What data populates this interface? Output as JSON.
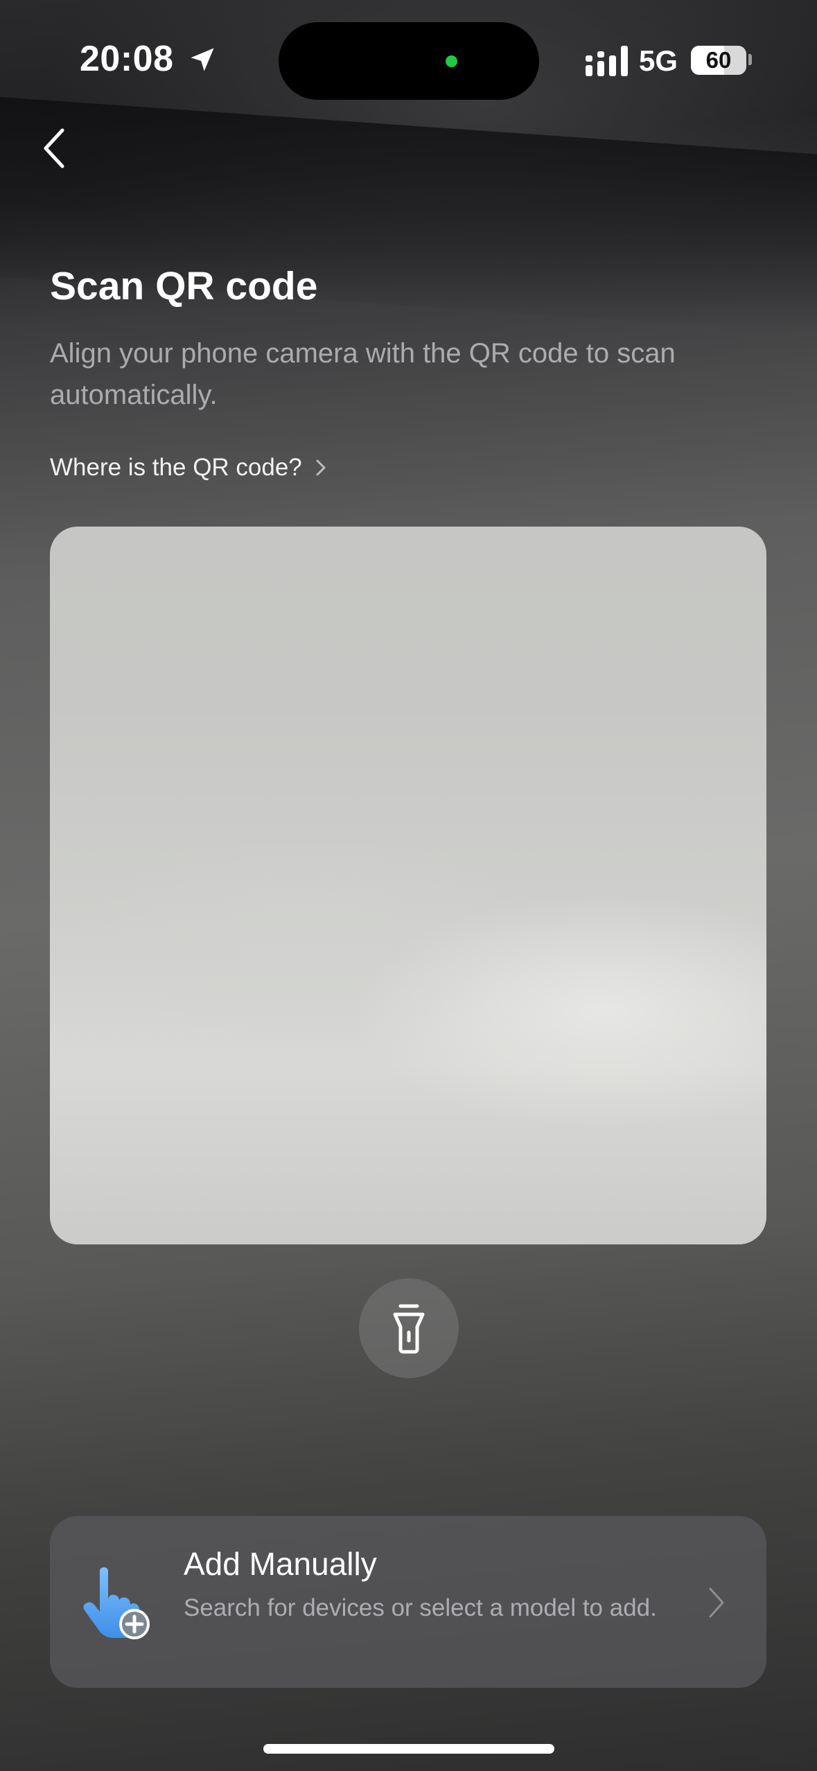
{
  "status_bar": {
    "time": "20:08",
    "network": "5G",
    "battery_percent": "60",
    "battery_level": 0.6,
    "location_icon": "location-arrow-icon",
    "signal_icon": "cellular-signal-icon",
    "island_indicator_color": "#1fcb45"
  },
  "nav": {
    "back_icon": "chevron-left-icon"
  },
  "header": {
    "title": "Scan QR code",
    "subtitle": "Align your phone camera with the QR code to scan automatically.",
    "help_link": "Where is the QR code?",
    "help_icon": "chevron-right-icon"
  },
  "scanner": {
    "flashlight_icon": "flashlight-icon"
  },
  "add_manually": {
    "title": "Add Manually",
    "subtitle": "Search for devices or select a model to add.",
    "icon": "tap-hand-add-icon",
    "chevron_icon": "chevron-right-icon",
    "icon_color": "#5aa9f5"
  }
}
